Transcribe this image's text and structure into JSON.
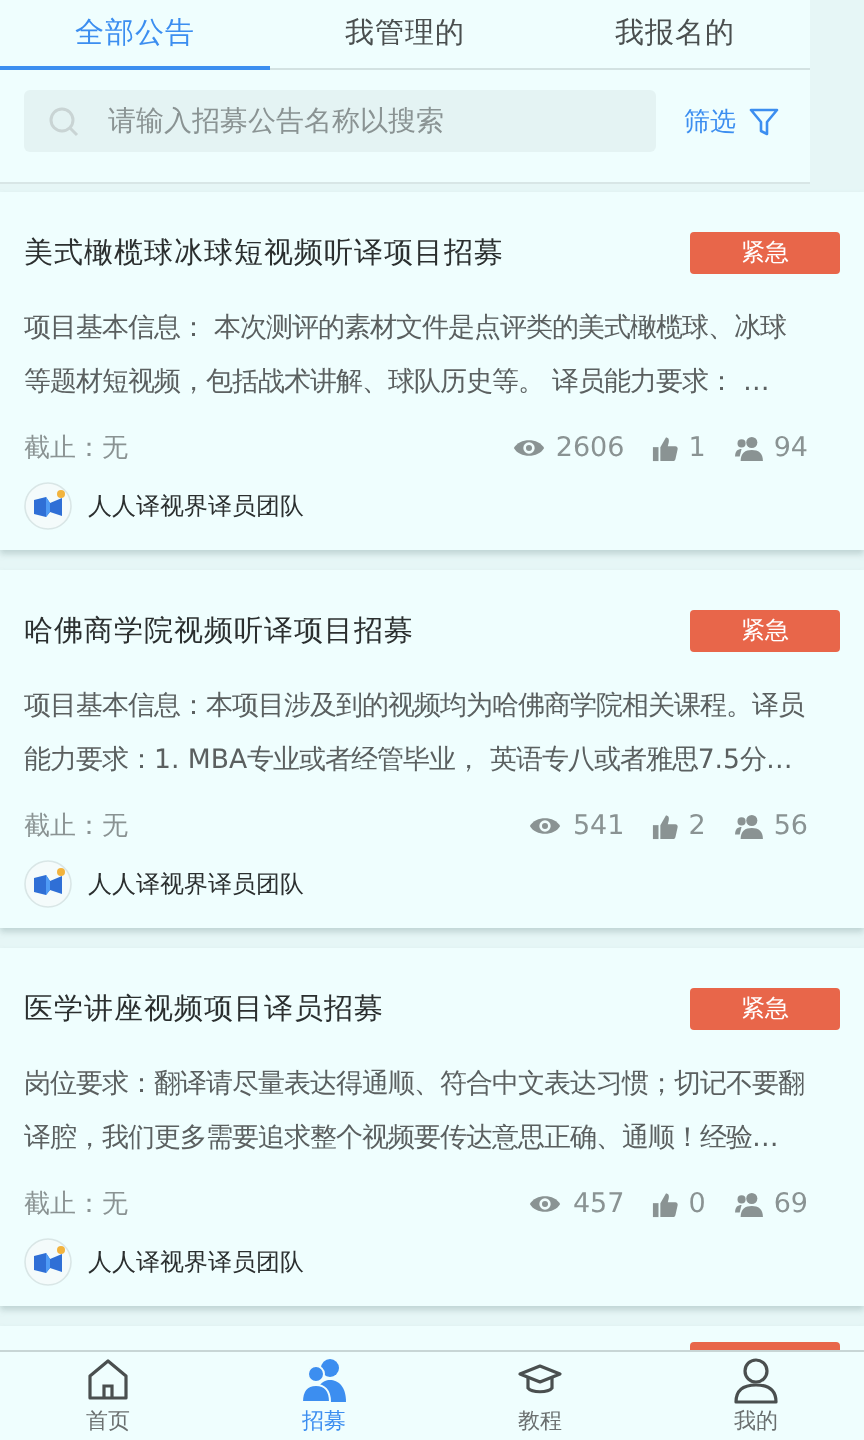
{
  "tabs": [
    {
      "label": "全部公告",
      "selected": true
    },
    {
      "label": "我管理的",
      "selected": false
    },
    {
      "label": "我报名的",
      "selected": false
    }
  ],
  "search": {
    "placeholder": "请输入招募公告名称以搜索"
  },
  "filter": {
    "label": "筛选"
  },
  "posts": [
    {
      "title": "美式橄榄球冰球短视频听译项目招募",
      "badge": "紧急",
      "description": "项目基本信息： 本次测评的素材文件是点评类的美式橄榄球、冰球等题材短视频，包括战术讲解、球队历史等。 译员能力要求： …",
      "deadline": "截止：无",
      "views": "2606",
      "likes": "1",
      "applicants": "94",
      "team": "人人译视界译员团队"
    },
    {
      "title": "哈佛商学院视频听译项目招募",
      "badge": "紧急",
      "description": "项目基本信息：本项目涉及到的视频均为哈佛商学院相关课程。译员能力要求：1. MBA专业或者经管毕业， 英语专八或者雅思7.5分…",
      "deadline": "截止：无",
      "views": "541",
      "likes": "2",
      "applicants": "56",
      "team": "人人译视界译员团队"
    },
    {
      "title": "医学讲座视频项目译员招募",
      "badge": "紧急",
      "description": "岗位要求：翻译请尽量表达得通顺、符合中文表达习惯；切记不要翻译腔，我们更多需要追求整个视频要传达意思正确、通顺！经验…",
      "deadline": "截止：无",
      "views": "457",
      "likes": "0",
      "applicants": "69",
      "team": "人人译视界译员团队"
    }
  ],
  "nav": [
    {
      "kind": "home",
      "label": "首页",
      "selected": false
    },
    {
      "kind": "people",
      "label": "招募",
      "selected": true
    },
    {
      "kind": "cap",
      "label": "教程",
      "selected": false
    },
    {
      "kind": "person",
      "label": "我的",
      "selected": false
    }
  ]
}
